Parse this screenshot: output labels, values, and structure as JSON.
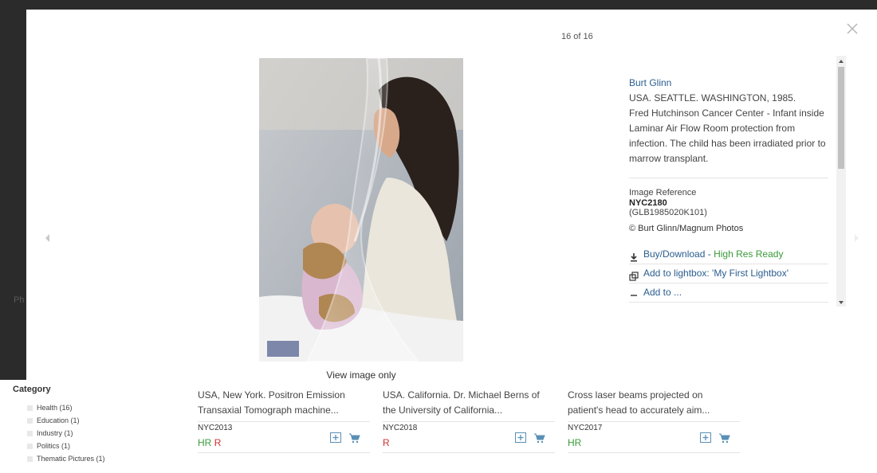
{
  "background": {
    "partial_text": "Ph"
  },
  "modal": {
    "counter": "16 of 16",
    "close_icon": "close-icon",
    "view_image_only": "View image only",
    "info": {
      "photographer": "Burt Glinn",
      "location": "USA. SEATTLE. WASHINGTON, 1985.",
      "caption": "Fred Hutchinson Cancer Center - Infant inside Laminar Air Flow Room protection from infection. The child has been irradiated prior to marrow transplant.",
      "ref_label": "Image Reference",
      "ref_code": "NYC2180",
      "ref_alt": "(GLB1985020K101)",
      "copyright": "© Burt Glinn/Magnum Photos",
      "actions": {
        "buy": "Buy/Download",
        "buy_status": "High Res Ready",
        "lightbox": "Add to lightbox: 'My First Lightbox'",
        "third": "Add to ..."
      }
    }
  },
  "categories": {
    "title": "Category",
    "items": [
      "Health (16)",
      "Education (1)",
      "Industry (1)",
      "Politics (1)",
      "Thematic Pictures (1)"
    ]
  },
  "cards": [
    {
      "title": "USA, New York. Positron Emission Transaxial Tomograph machine...",
      "code": "NYC2013",
      "tag_hr": "HR",
      "tag_r": "R"
    },
    {
      "title": "USA. California. Dr. Michael Berns of the University of California...",
      "code": "NYC2018",
      "tag_hr": "",
      "tag_r": "R"
    },
    {
      "title": "Cross laser beams projected on patient's head to accurately aim...",
      "code": "NYC2017",
      "tag_hr": "HR",
      "tag_r": ""
    }
  ],
  "colors": {
    "link": "#2a5d8f",
    "green": "#3a9a3a",
    "red": "#d03030",
    "overlay": "#2b2b2b"
  }
}
